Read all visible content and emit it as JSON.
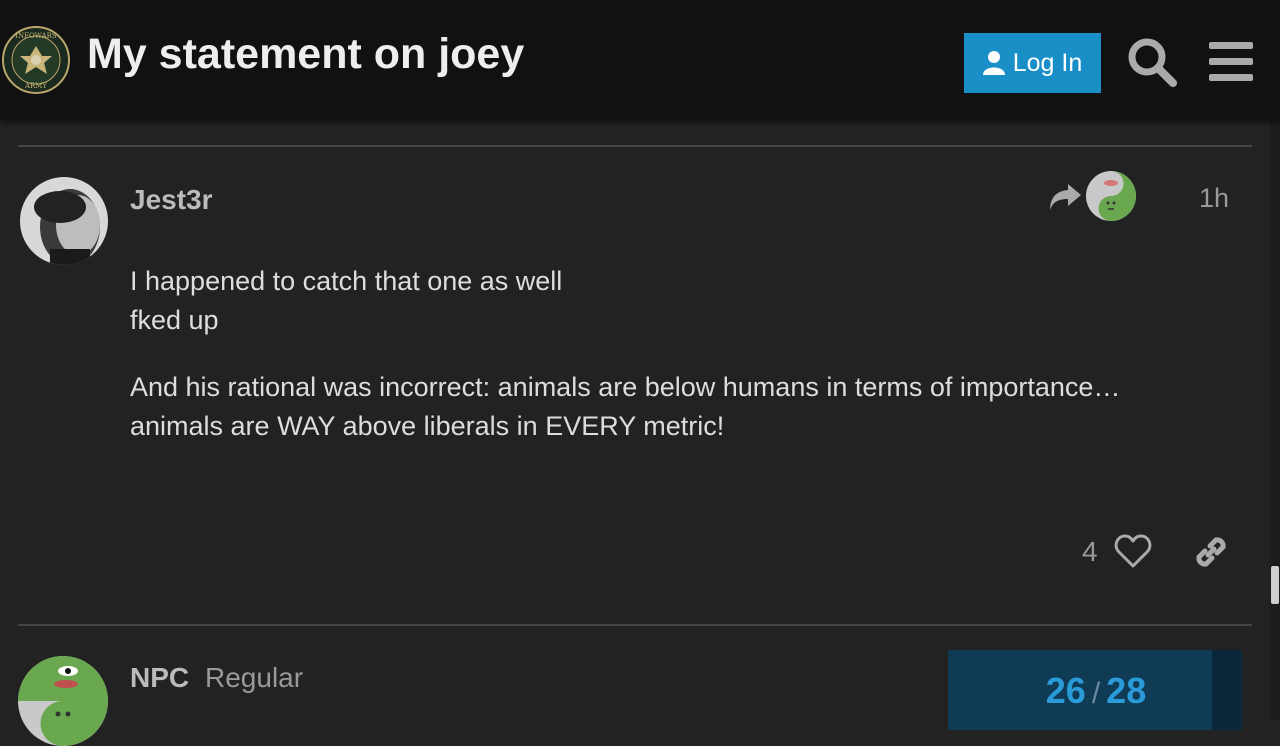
{
  "header": {
    "title": "My statement on joey",
    "login_label": "Log In",
    "logo_icon": "army-seal-logo-icon",
    "logo_text_top": "INFOWARS",
    "logo_text_bottom": "ARMY"
  },
  "posts": [
    {
      "username": "Jest3r",
      "date": "1h",
      "paragraphs": [
        [
          "I happened to catch that one as well",
          "fked up"
        ],
        [
          "And his rational was incorrect: animals are below humans in terms of importance…",
          "animals are WAY above liberals in EVERY metric!"
        ]
      ],
      "likes": "4"
    },
    {
      "username": "NPC",
      "user_title": "Regular"
    }
  ],
  "progress": {
    "current": "26",
    "separator": "/",
    "total": "28"
  },
  "colors": {
    "accent": "#1a8fc7",
    "header_bg": "#111111",
    "page_bg": "#222222",
    "progress_text": "#2a9ad8"
  }
}
